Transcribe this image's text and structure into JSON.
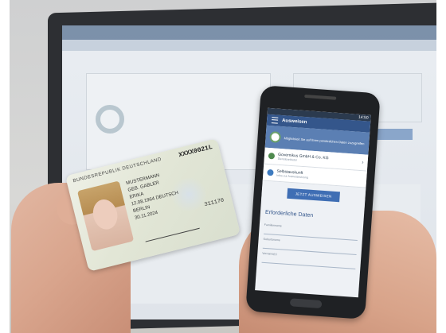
{
  "phone": {
    "status_time": "14:50",
    "app_title": "Ausweisen",
    "intro_text": "Möglichkeit Sie auf Ihren persönlichen Daten zuzugreifen",
    "provider_name": "Governikus GmbH & Co. KG",
    "provider_sub": "Diensteanbieter",
    "selfauth_name": "Selbstauskunft",
    "selfauth_sub": "Infos zur Ausweisnutzung",
    "button_label": "JETZT AUSWEISEN",
    "section_title": "Erforderliche Daten",
    "fields": [
      "Familienname",
      "Geburtsname",
      "Vorname(n)"
    ]
  },
  "id_card": {
    "header": "BUNDESREPUBLIK DEUTSCHLAND",
    "number": "XXXX0021L",
    "lines": [
      "MUSTERMANN",
      "GEB. GABLER",
      "ERIKA",
      "12.08.1964  DEUTSCH",
      "BERLIN",
      "30.11.2024"
    ],
    "code": "311170"
  }
}
